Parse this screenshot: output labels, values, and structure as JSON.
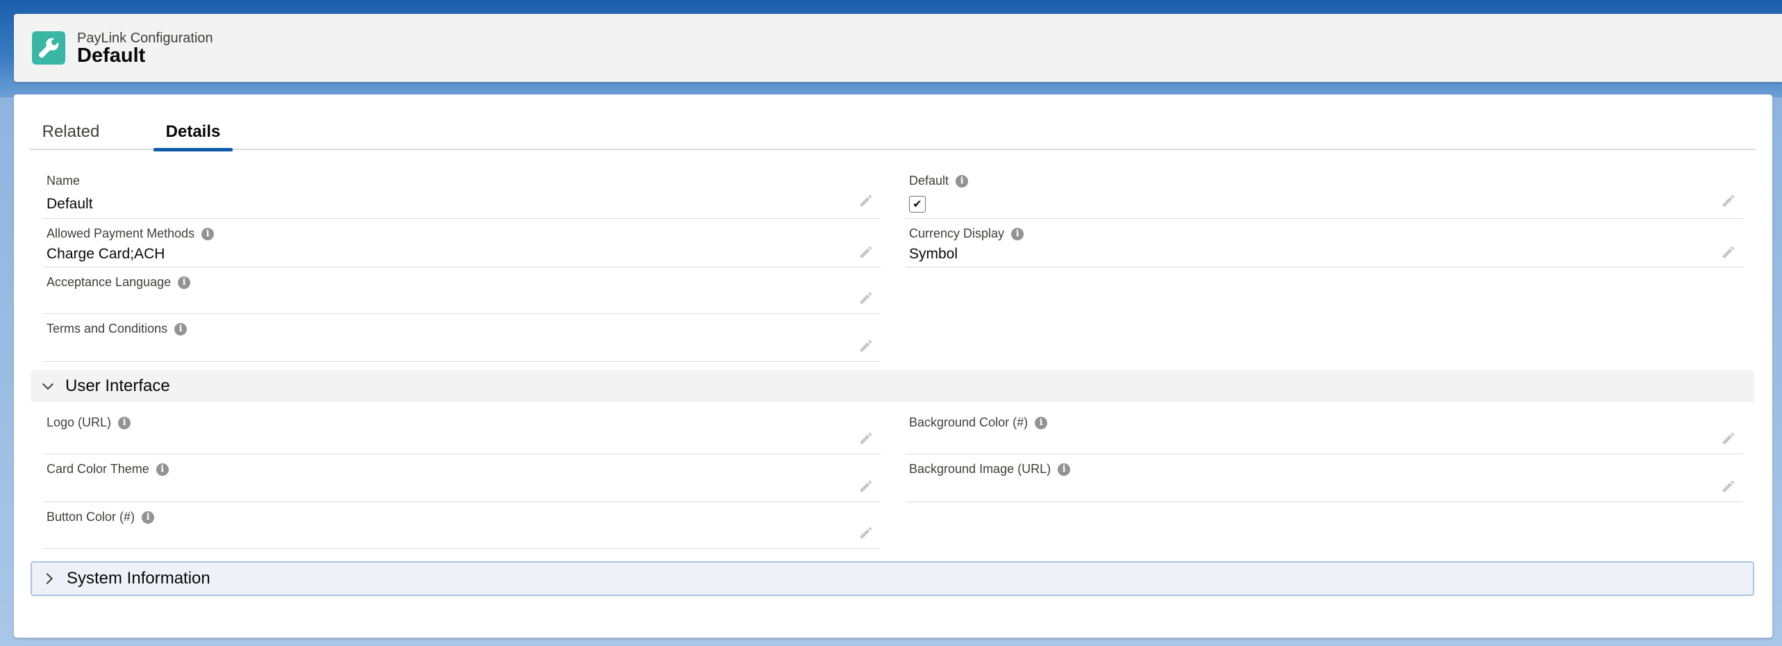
{
  "record": {
    "object_type": "PayLink Configuration",
    "name": "Default",
    "icon": "wrench-icon",
    "icon_color": "#3ab6a4"
  },
  "tabs": [
    {
      "label": "Related",
      "active": false
    },
    {
      "label": "Details",
      "active": true
    }
  ],
  "details": {
    "name": {
      "label": "Name",
      "value": "Default"
    },
    "default": {
      "label": "Default",
      "checked": true,
      "check_glyph": "✔"
    },
    "allowed_payment_methods": {
      "label": "Allowed Payment Methods",
      "value": "Charge Card;ACH"
    },
    "currency_display": {
      "label": "Currency Display",
      "value": "Symbol"
    },
    "acceptance_language": {
      "label": "Acceptance Language",
      "value": ""
    },
    "terms_and_conditions": {
      "label": "Terms and Conditions",
      "value": ""
    }
  },
  "user_interface": {
    "title": "User Interface",
    "expanded": true,
    "logo_url": {
      "label": "Logo (URL)",
      "value": ""
    },
    "background_color": {
      "label": "Background Color (#)",
      "value": ""
    },
    "card_color_theme": {
      "label": "Card Color Theme",
      "value": ""
    },
    "background_image_url": {
      "label": "Background Image (URL)",
      "value": ""
    },
    "button_color": {
      "label": "Button Color (#)",
      "value": ""
    }
  },
  "system_information": {
    "title": "System Information",
    "expanded": false
  },
  "colors": {
    "accent": "#0b5cab",
    "header_bg": "#f3f3f3"
  }
}
